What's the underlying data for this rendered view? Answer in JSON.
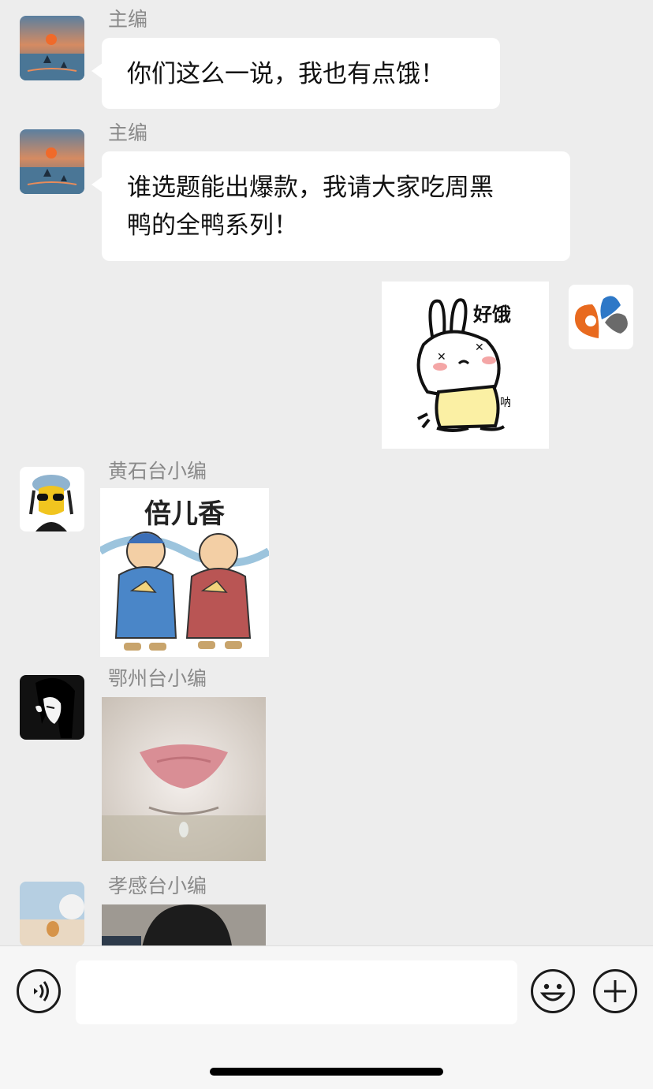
{
  "messages": [
    {
      "sender": "主编",
      "text": "你们这么一说，我也有点饿！"
    },
    {
      "sender": "主编",
      "text_line1": "谁选题能出爆款，我请大家吃周黑",
      "text_line2": "鸭的全鸭系列！"
    },
    {
      "sticker_text": "好饿",
      "sticker_small": "呐"
    },
    {
      "sender": "黄石台小编",
      "sticker_text": "倍儿香"
    },
    {
      "sender": "鄂州台小编"
    },
    {
      "sender": "孝感台小编"
    }
  ],
  "input": {
    "placeholder": ""
  },
  "icons": {
    "voice": "voice-icon",
    "emoji": "emoji-icon",
    "plus": "plus-icon"
  }
}
